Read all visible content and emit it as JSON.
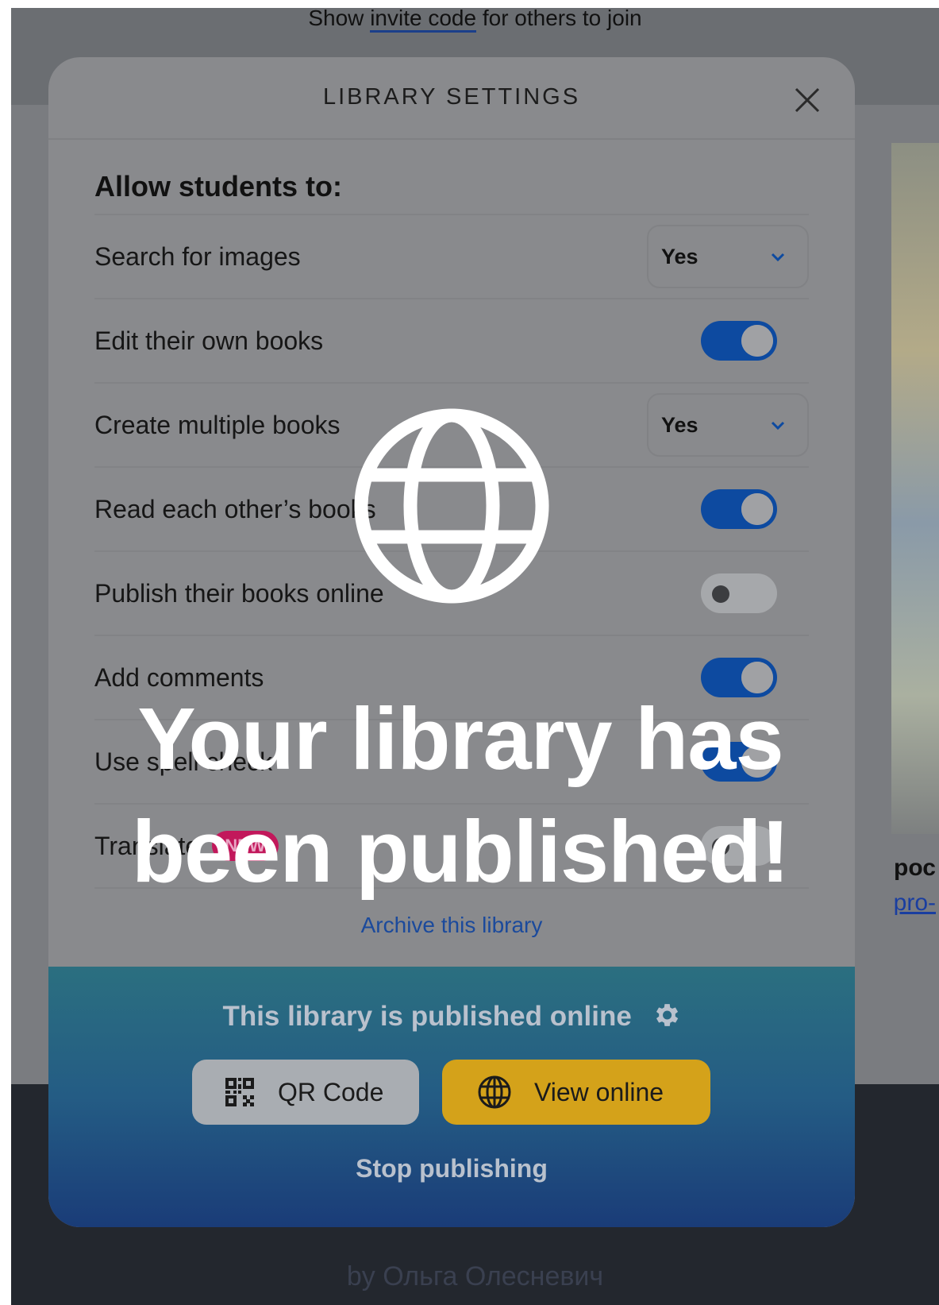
{
  "background": {
    "invite_prefix": "Show ",
    "invite_link": "invite code",
    "invite_suffix": " for others to join",
    "side_text_1": "рос",
    "side_text_2": "pro-",
    "author": "by Ольга Олесневич"
  },
  "modal": {
    "title": "LIBRARY SETTINGS",
    "section_title": "Allow students to:",
    "settings": [
      {
        "label": "Search for images",
        "control": "select",
        "value": "Yes"
      },
      {
        "label": "Edit their own books",
        "control": "toggle",
        "value": "on"
      },
      {
        "label": "Create multiple books",
        "control": "select",
        "value": "Yes"
      },
      {
        "label": "Read each other’s books",
        "control": "toggle",
        "value": "on"
      },
      {
        "label": "Publish their books online",
        "control": "toggle",
        "value": "off"
      },
      {
        "label": "Add comments",
        "control": "toggle",
        "value": "on"
      },
      {
        "label": "Use spell check",
        "control": "toggle",
        "value": "on"
      },
      {
        "label": "Translate",
        "control": "toggle",
        "value": "off",
        "badge": "NEW"
      }
    ],
    "archive_link": "Archive this library"
  },
  "publish": {
    "title": "This library is published online",
    "qr_button": "QR Code",
    "view_button": "View online",
    "stop_link": "Stop publishing"
  },
  "overlay": {
    "message": "Your library has been published!",
    "icon": "globe-icon"
  },
  "colors": {
    "toggle_on": "#0d4aa0",
    "view_button": "#d4a21a",
    "new_badge": "#c2185b",
    "link": "#1b4a9c"
  }
}
